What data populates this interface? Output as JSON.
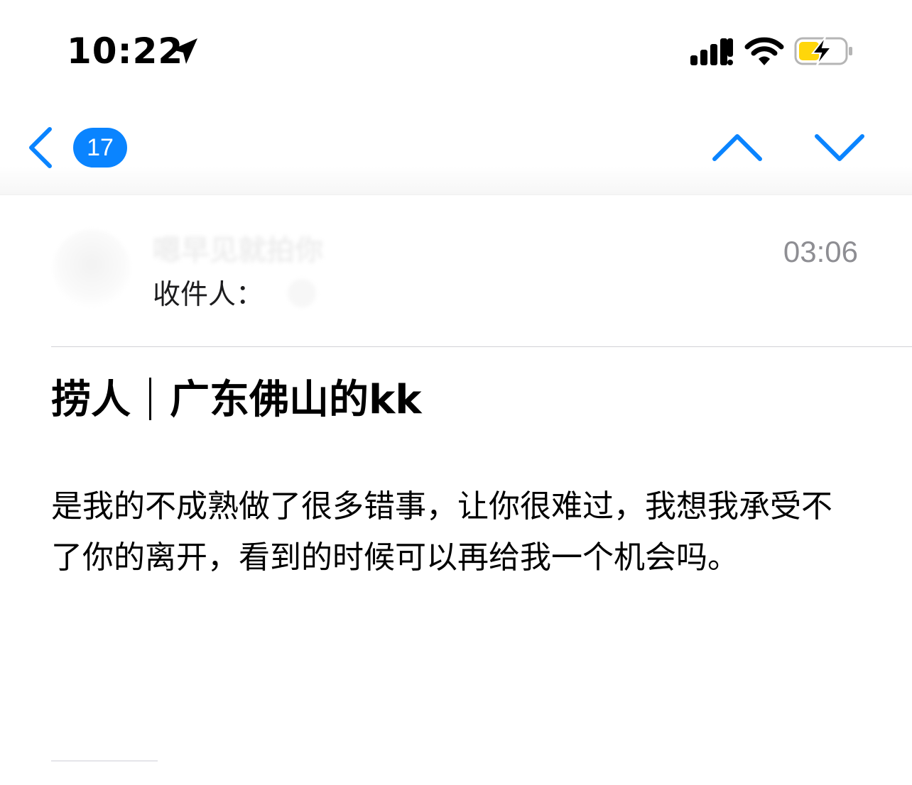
{
  "status_bar": {
    "time": "10:22",
    "icons": [
      "location-arrow-icon",
      "cellular-signal-icon",
      "wifi-icon",
      "battery-charging-icon"
    ],
    "battery_color": "#ffd60a"
  },
  "nav": {
    "unread_count": "17",
    "accent_color": "#0a84ff",
    "icons": [
      "chevron-left-icon",
      "chevron-up-icon",
      "chevron-down-icon"
    ]
  },
  "message": {
    "sender_name": "嗯早见就拍你",
    "time": "03:06",
    "recipient_label": "收件人：",
    "subject_part1": "捞人",
    "subject_part2": "广东佛山的kk",
    "body": "是我的不成熟做了很多错事，让你很难过，我想我承受不了你的离开，看到的时候可以再给我一个机会吗。"
  }
}
